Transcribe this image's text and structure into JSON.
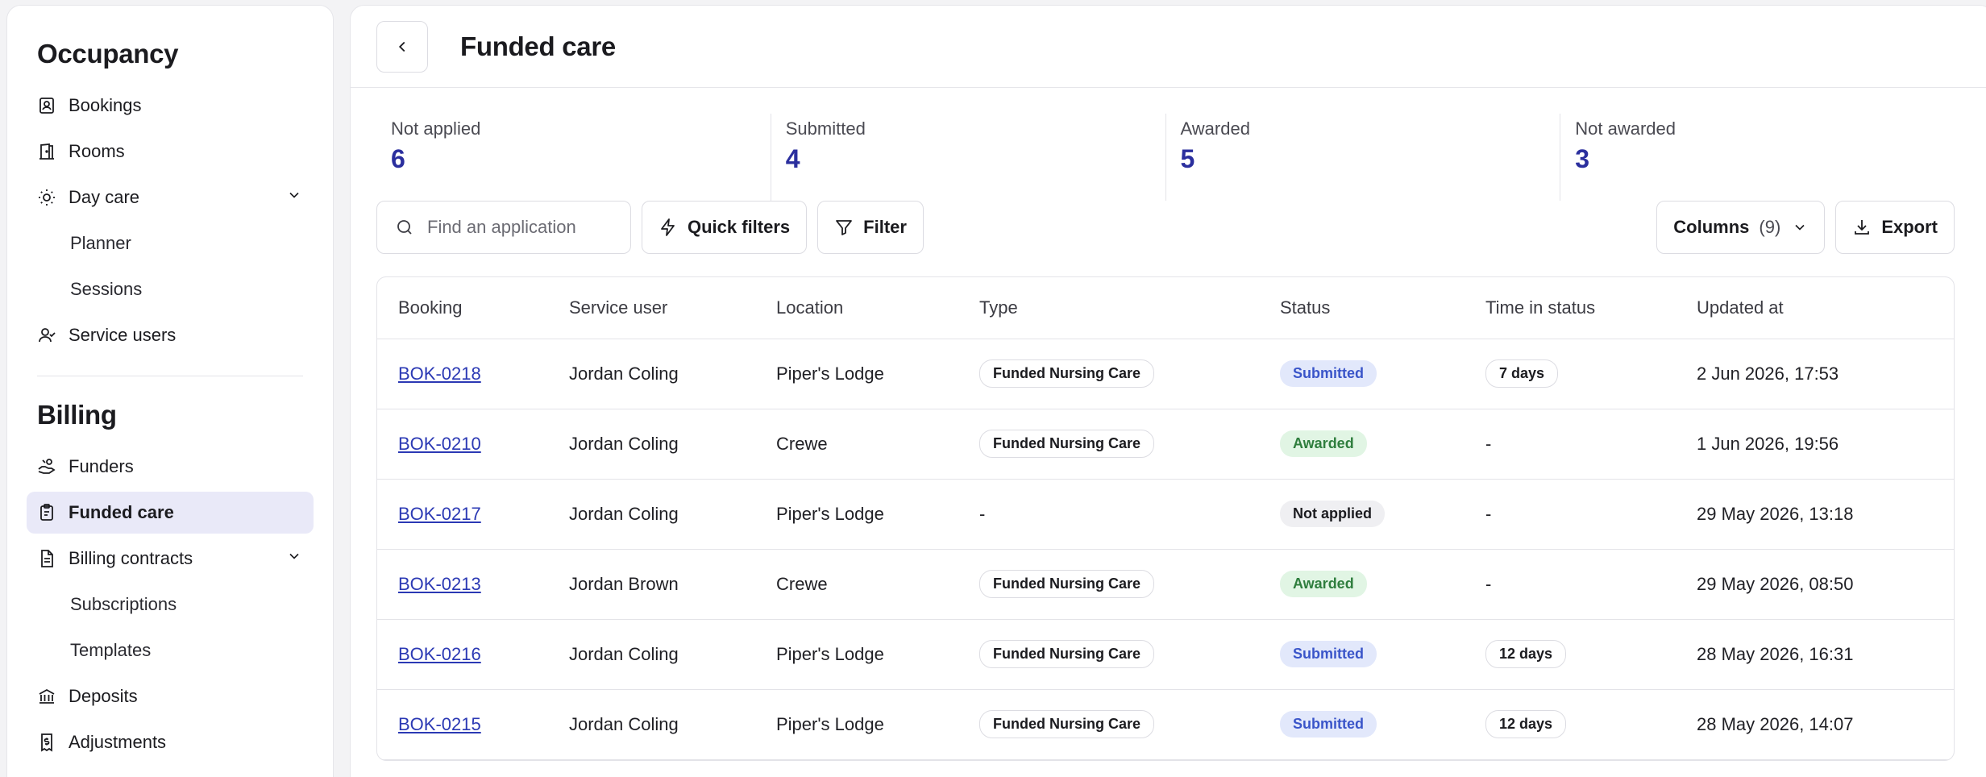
{
  "sidebar": {
    "occupancy_title": "Occupancy",
    "occupancy_items": [
      {
        "label": "Bookings"
      },
      {
        "label": "Rooms"
      },
      {
        "label": "Day care"
      },
      {
        "label": "Planner"
      },
      {
        "label": "Sessions"
      },
      {
        "label": "Service users"
      }
    ],
    "billing_title": "Billing",
    "billing_items": [
      {
        "label": "Funders"
      },
      {
        "label": "Funded care"
      },
      {
        "label": "Billing contracts"
      },
      {
        "label": "Subscriptions"
      },
      {
        "label": "Templates"
      },
      {
        "label": "Deposits"
      },
      {
        "label": "Adjustments"
      }
    ]
  },
  "header": {
    "title": "Funded care"
  },
  "stats": [
    {
      "label": "Not applied",
      "value": "6"
    },
    {
      "label": "Submitted",
      "value": "4"
    },
    {
      "label": "Awarded",
      "value": "5"
    },
    {
      "label": "Not awarded",
      "value": "3"
    }
  ],
  "toolbar": {
    "search_placeholder": "Find an application",
    "quick_filters_label": "Quick filters",
    "filter_label": "Filter",
    "columns_label": "Columns",
    "columns_count": "(9)",
    "export_label": "Export"
  },
  "table": {
    "columns": [
      "Booking",
      "Service user",
      "Location",
      "Type",
      "Status",
      "Time in status",
      "Updated at"
    ],
    "rows": [
      {
        "booking": "BOK-0218",
        "user": "Jordan Coling",
        "location": "Piper's Lodge",
        "type": "Funded Nursing Care",
        "status": "Submitted",
        "time": "7 days",
        "updated": "2 Jun 2026, 17:53"
      },
      {
        "booking": "BOK-0210",
        "user": "Jordan Coling",
        "location": "Crewe",
        "type": "Funded Nursing Care",
        "status": "Awarded",
        "time": "-",
        "updated": "1 Jun 2026, 19:56"
      },
      {
        "booking": "BOK-0217",
        "user": "Jordan Coling",
        "location": "Piper's Lodge",
        "type": "-",
        "status": "Not applied",
        "time": "-",
        "updated": "29 May 2026, 13:18"
      },
      {
        "booking": "BOK-0213",
        "user": "Jordan Brown",
        "location": "Crewe",
        "type": "Funded Nursing Care",
        "status": "Awarded",
        "time": "-",
        "updated": "29 May 2026, 08:50"
      },
      {
        "booking": "BOK-0216",
        "user": "Jordan Coling",
        "location": "Piper's Lodge",
        "type": "Funded Nursing Care",
        "status": "Submitted",
        "time": "12 days",
        "updated": "28 May 2026, 16:31"
      },
      {
        "booking": "BOK-0215",
        "user": "Jordan Coling",
        "location": "Piper's Lodge",
        "type": "Funded Nursing Care",
        "status": "Submitted",
        "time": "12 days",
        "updated": "28 May 2026, 14:07"
      }
    ]
  }
}
